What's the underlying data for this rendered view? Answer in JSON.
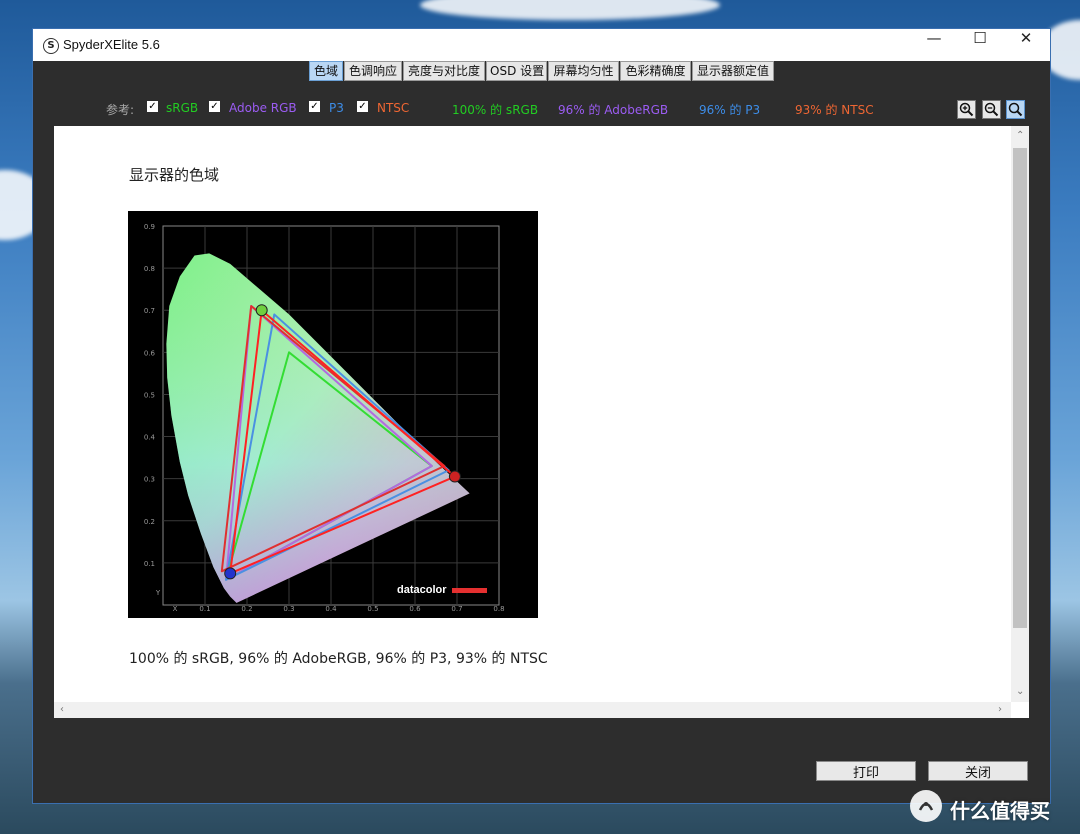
{
  "window": {
    "title": "SpyderXElite 5.6"
  },
  "tabs": [
    {
      "label": "色域",
      "active": true
    },
    {
      "label": "色调响应"
    },
    {
      "label": "亮度与对比度"
    },
    {
      "label": "OSD 设置"
    },
    {
      "label": "屏幕均匀性"
    },
    {
      "label": "色彩精确度"
    },
    {
      "label": "显示器额定值"
    }
  ],
  "reference": {
    "label": "参考:",
    "standards": [
      {
        "name": "sRGB",
        "checked": true,
        "color": "#22cc22"
      },
      {
        "name": "Adobe RGB",
        "checked": true,
        "color": "#9b5cf2"
      },
      {
        "name": "P3",
        "checked": true,
        "color": "#3d8de8"
      },
      {
        "name": "NTSC",
        "checked": true,
        "color": "#ee6633"
      }
    ],
    "results": [
      {
        "text": "100% 的 sRGB",
        "color": "#22cc22"
      },
      {
        "text": "96% 的 AdobeRGB",
        "color": "#9b5cf2"
      },
      {
        "text": "96% 的 P3",
        "color": "#3d8de8"
      },
      {
        "text": "93% 的 NTSC",
        "color": "#ee6633"
      }
    ],
    "zoom_icons": [
      "zoom-in-icon",
      "zoom-out-icon",
      "zoom-reset-icon"
    ]
  },
  "report": {
    "heading": "显示器的色域",
    "caption": "100% 的 sRGB, 96% 的 AdobeRGB, 96% 的 P3, 93% 的 NTSC"
  },
  "chart_data": {
    "type": "scatter",
    "title": "",
    "xlabel": "x",
    "ylabel": "y",
    "xlim": [
      0,
      0.8
    ],
    "ylim": [
      0,
      0.9
    ],
    "x_ticks": [
      "0.1",
      "0.2",
      "0.3",
      "0.4",
      "0.5",
      "0.6",
      "0.7",
      "0.8"
    ],
    "y_ticks": [
      "0.1",
      "0.2",
      "0.3",
      "0.4",
      "0.5",
      "0.6",
      "0.7",
      "0.8",
      "0.9"
    ],
    "grid": true,
    "logo_text": "datacolor",
    "series": [
      {
        "key": "srgb",
        "color": "#33dd33",
        "points": [
          [
            0.64,
            0.33
          ],
          [
            0.3,
            0.6
          ],
          [
            0.15,
            0.06
          ]
        ]
      },
      {
        "key": "adobergb",
        "color": "#b36ae0",
        "points": [
          [
            0.64,
            0.33
          ],
          [
            0.21,
            0.71
          ],
          [
            0.15,
            0.06
          ]
        ]
      },
      {
        "key": "p3",
        "color": "#4a90e2",
        "points": [
          [
            0.68,
            0.32
          ],
          [
            0.265,
            0.69
          ],
          [
            0.15,
            0.06
          ]
        ]
      },
      {
        "key": "ntsc",
        "color": "#e03030",
        "points": [
          [
            0.67,
            0.33
          ],
          [
            0.21,
            0.71
          ],
          [
            0.14,
            0.08
          ]
        ]
      },
      {
        "key": "measured",
        "color": "#ff2222",
        "points": [
          [
            0.695,
            0.305
          ],
          [
            0.235,
            0.7
          ],
          [
            0.16,
            0.075
          ]
        ]
      }
    ],
    "primaries": [
      {
        "name": "red",
        "x": 0.695,
        "y": 0.305,
        "color": "#cc2222"
      },
      {
        "name": "green",
        "x": 0.235,
        "y": 0.7,
        "color": "#6fcf3f"
      },
      {
        "name": "blue",
        "x": 0.16,
        "y": 0.075,
        "color": "#2233cc"
      }
    ],
    "locus": [
      [
        0.175,
        0.005
      ],
      [
        0.17,
        0.01
      ],
      [
        0.16,
        0.02
      ],
      [
        0.145,
        0.04
      ],
      [
        0.12,
        0.09
      ],
      [
        0.09,
        0.17
      ],
      [
        0.06,
        0.26
      ],
      [
        0.04,
        0.34
      ],
      [
        0.02,
        0.45
      ],
      [
        0.01,
        0.54
      ],
      [
        0.008,
        0.62
      ],
      [
        0.015,
        0.71
      ],
      [
        0.04,
        0.78
      ],
      [
        0.075,
        0.83
      ],
      [
        0.11,
        0.835
      ],
      [
        0.16,
        0.81
      ],
      [
        0.23,
        0.75
      ],
      [
        0.3,
        0.69
      ],
      [
        0.37,
        0.62
      ],
      [
        0.44,
        0.55
      ],
      [
        0.51,
        0.48
      ],
      [
        0.58,
        0.41
      ],
      [
        0.65,
        0.34
      ],
      [
        0.73,
        0.265
      ]
    ]
  },
  "buttons": {
    "print": "打印",
    "close": "关闭"
  },
  "watermark": {
    "text": "什么值得买"
  }
}
